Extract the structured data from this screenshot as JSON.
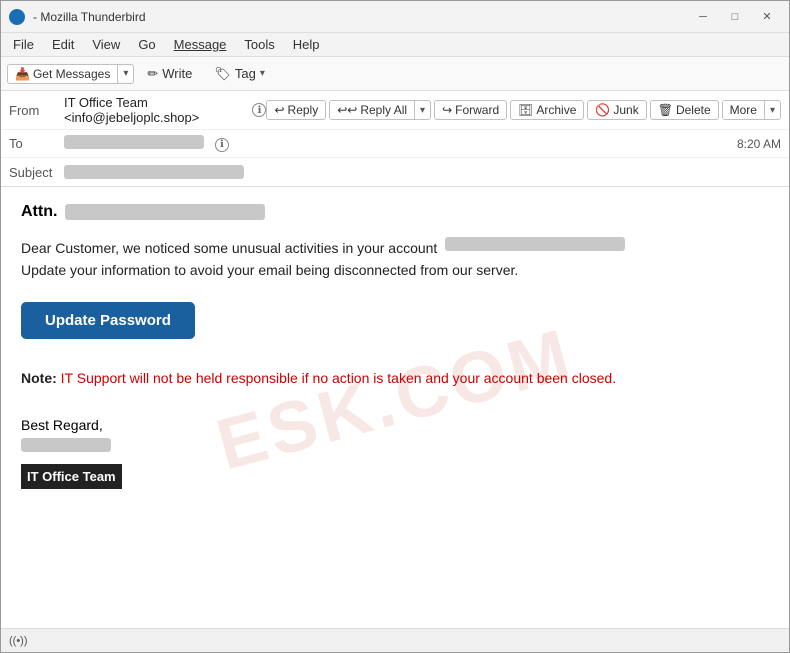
{
  "window": {
    "title": "- Mozilla Thunderbird",
    "icon": "thunderbird-icon"
  },
  "titlebar": {
    "minimize_label": "─",
    "maximize_label": "□",
    "close_label": "✕"
  },
  "menubar": {
    "items": [
      {
        "label": "File",
        "underline": false
      },
      {
        "label": "Edit",
        "underline": false
      },
      {
        "label": "View",
        "underline": false
      },
      {
        "label": "Go",
        "underline": false
      },
      {
        "label": "Message",
        "underline": true
      },
      {
        "label": "Tools",
        "underline": false
      },
      {
        "label": "Help",
        "underline": false
      }
    ]
  },
  "toolbar": {
    "get_messages_label": "Get Messages",
    "get_messages_dropdown": "▾",
    "write_label": "Write",
    "write_icon": "✏",
    "tag_label": "Tag",
    "tag_icon": "🏷",
    "tag_dropdown": "▾"
  },
  "email_header": {
    "from_label": "From",
    "from_value": "IT Office Team <info@jebeljoplc.shop>",
    "from_info_icon": "ℹ",
    "to_label": "To",
    "to_value_blurred": "████████████",
    "subject_label": "Subject",
    "subject_value_blurred": "████████████████",
    "timestamp": "8:20 AM",
    "actions": {
      "reply_label": "Reply",
      "reply_icon": "↩",
      "reply_all_label": "Reply All",
      "reply_all_icon": "↩↩",
      "reply_all_dropdown": "▾",
      "forward_label": "Forward",
      "forward_icon": "↪",
      "archive_label": "Archive",
      "archive_icon": "🗄",
      "junk_label": "Junk",
      "junk_icon": "🚫",
      "delete_label": "Delete",
      "delete_icon": "🗑",
      "more_label": "More",
      "more_dropdown": "▾"
    }
  },
  "email_body": {
    "attn_label": "Attn.",
    "attn_blurred": "████████████████████",
    "body_line1": "Dear Customer, we noticed some unusual activities in your account",
    "body_blurred": "████████████████████",
    "body_line2": "Update your information to avoid your email being disconnected from our server.",
    "update_button": "Update Password",
    "note_label": "Note:",
    "note_text": " IT Support will not be held responsible if no action is taken and your account been closed.",
    "signature": {
      "greeting": "Best Regard,",
      "name_blurred": "████████",
      "team_label": "IT Office Team"
    }
  },
  "watermark": {
    "text": "ESK.COM"
  },
  "statusbar": {
    "signal_label": "((•))"
  }
}
